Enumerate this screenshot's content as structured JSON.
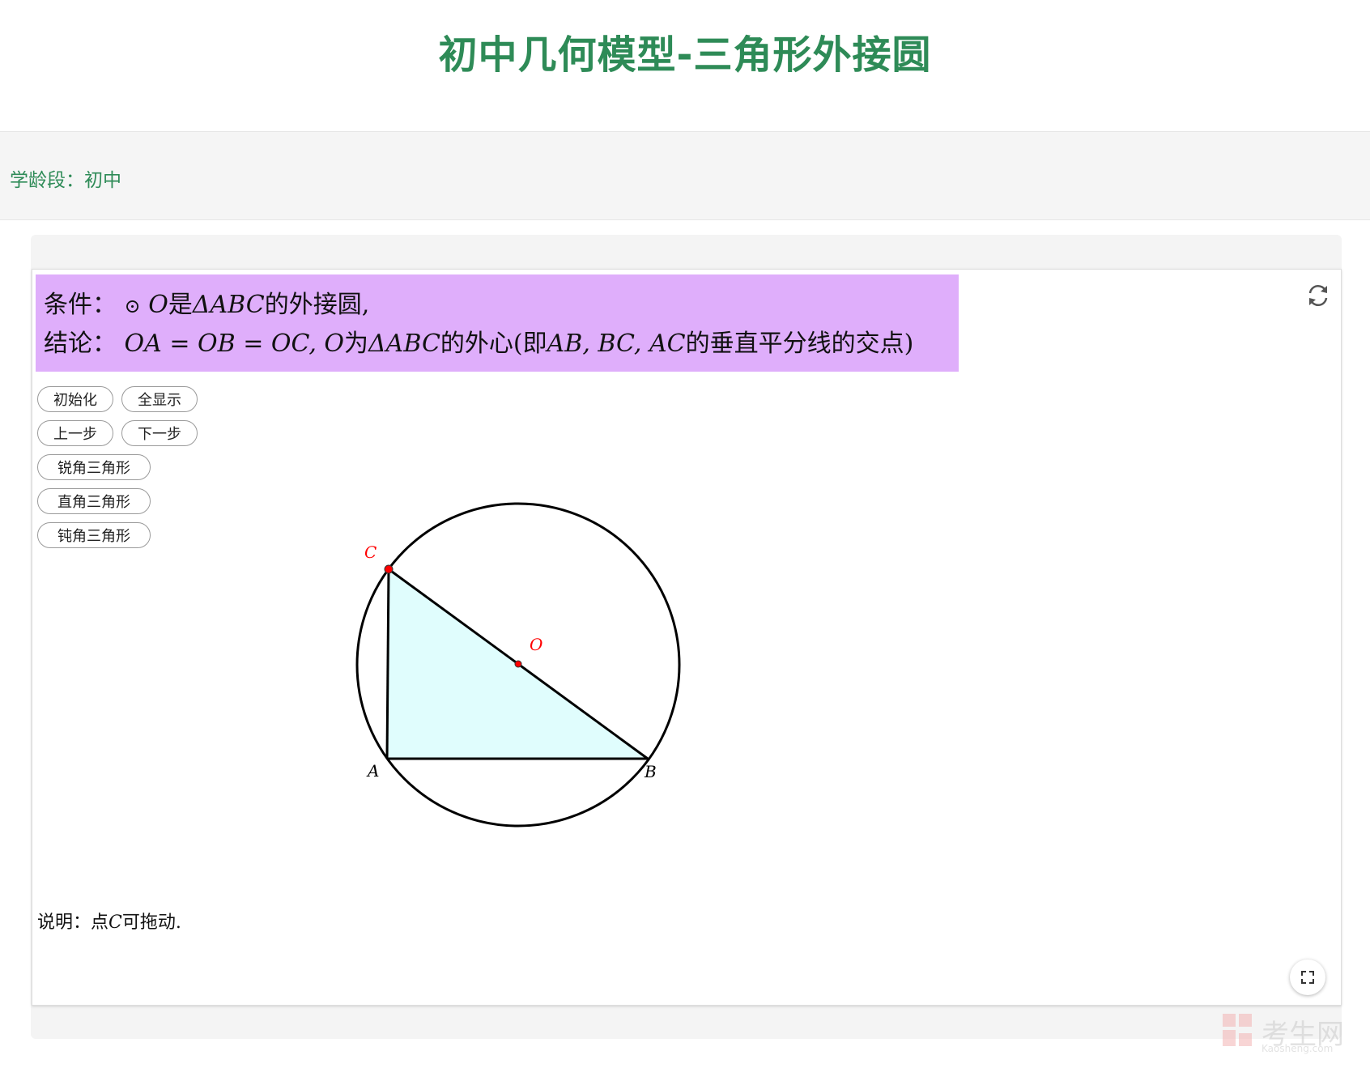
{
  "page": {
    "title": "初中几何模型-三角形外接圆"
  },
  "meta": {
    "label": "学龄段：",
    "value": "初中"
  },
  "condition": {
    "cond_label": "条件：",
    "cond_circle": "⊙",
    "cond_o": "O",
    "cond_is": "是",
    "cond_tri": "ΔABC",
    "cond_tail": "的外接圆,",
    "conc_label": "结论：",
    "conc_eq": "OA = OB = OC, O",
    "conc_mid": "为",
    "conc_tri": "ΔABC",
    "conc_text1": "的外心(即",
    "conc_sides": "AB, BC, AC",
    "conc_text2": "的垂直平分线的交点)"
  },
  "buttons": {
    "init": "初始化",
    "show_all": "全显示",
    "prev": "上一步",
    "next": "下一步",
    "acute": "锐角三角形",
    "right": "直角三角形",
    "obtuse": "钝角三角形"
  },
  "figure": {
    "labels": {
      "A": "A",
      "B": "B",
      "C": "C",
      "O": "O"
    },
    "colors": {
      "fill": "#e0fdfd",
      "point": "#ff0000",
      "stroke": "#000000",
      "label_red": "#ff0000"
    }
  },
  "note": {
    "prefix": "说明：点",
    "point": "C",
    "suffix": "可拖动."
  },
  "icons": {
    "refresh": "refresh-icon",
    "fullscreen": "fullscreen-icon"
  },
  "watermark": {
    "text": "考生网",
    "sub": "Kaosheng.com"
  },
  "colors": {
    "title": "#2e8b57",
    "meta_text": "#2e8b57",
    "condition_bg": "#dfaefb"
  }
}
